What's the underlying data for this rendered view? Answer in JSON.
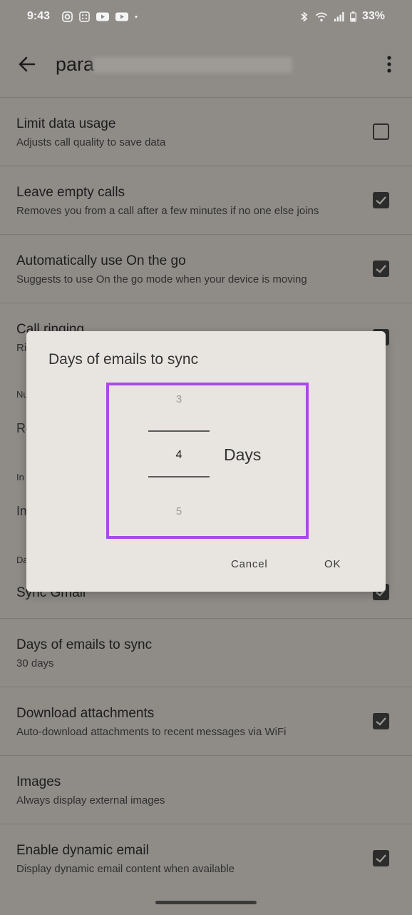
{
  "status_bar": {
    "time": "9:43",
    "battery": "33%",
    "left_icons": [
      "instagram-icon",
      "app-grid-icon",
      "youtube-icon",
      "youtube-icon",
      "dot-icon"
    ],
    "right_icons": [
      "bluetooth-icon",
      "wifi-icon",
      "signal-icon",
      "battery-icon"
    ]
  },
  "app_bar": {
    "title_visible": "para",
    "title_obscured": "[blurred email]@gmail.com"
  },
  "settings": [
    {
      "title": "Limit data usage",
      "subtitle": "Adjusts call quality to save data",
      "checked": false
    },
    {
      "title": "Leave empty calls",
      "subtitle": "Removes you from a call after a few minutes if no one else joins",
      "checked": true
    },
    {
      "title": "Automatically use On the go",
      "subtitle": "Suggests to use On the go mode when your device is moving",
      "checked": true
    },
    {
      "title": "Call ringing",
      "subtitle": "Ri",
      "checked": true
    },
    {
      "title": "Sync Gmail",
      "checked": true
    },
    {
      "title": "Days of emails to sync",
      "subtitle": "30 days"
    },
    {
      "title": "Download attachments",
      "subtitle": "Auto-download attachments to recent messages via WiFi",
      "checked": true
    },
    {
      "title": "Images",
      "subtitle": "Always display external images"
    },
    {
      "title": "Enable dynamic email",
      "subtitle": "Display dynamic email content when available",
      "checked": true
    }
  ],
  "clipped_fragments": [
    "Nu",
    "Re",
    "In",
    "Im",
    "Da"
  ],
  "dialog": {
    "title": "Days of emails to sync",
    "picker": {
      "prev": "3",
      "selected": "4",
      "next": "5",
      "unit": "Days"
    },
    "cancel": "Cancel",
    "ok": "OK"
  },
  "colors": {
    "highlight": "#a64be8",
    "dialog_bg": "#e8e5e0",
    "scrim_bg": "#8f8c88"
  }
}
